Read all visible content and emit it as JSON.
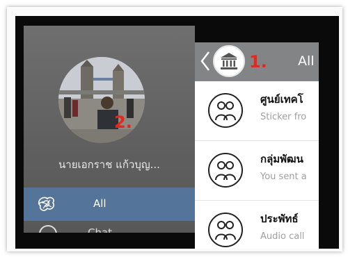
{
  "drawer": {
    "user_name": "นายเอกราช แก้วบุญ...",
    "menu": [
      {
        "label": "All",
        "icon": "scribble-icon",
        "selected": true
      },
      {
        "label": "Chat",
        "icon": "circle-icon",
        "selected": false
      }
    ]
  },
  "header": {
    "title": "All",
    "logo_icon": "government-building-icon",
    "back_icon": "chevron-left-icon"
  },
  "annotations": {
    "marker_1": "1.",
    "marker_2": "2.",
    "color": "#e5281e"
  },
  "conversations": [
    {
      "title": "ศูนย์เทคโ",
      "subtitle": "Sticker fro",
      "icon": "group-icon"
    },
    {
      "title": "กลุ่มพัฒน",
      "subtitle": "You sent a",
      "icon": "group-icon"
    },
    {
      "title": "ประพัทธ์",
      "subtitle": "Audio call",
      "icon": "group-icon"
    }
  ],
  "colors": {
    "selected_menu": "#54749a",
    "topbar": "#838486",
    "drawer": "#666666"
  }
}
